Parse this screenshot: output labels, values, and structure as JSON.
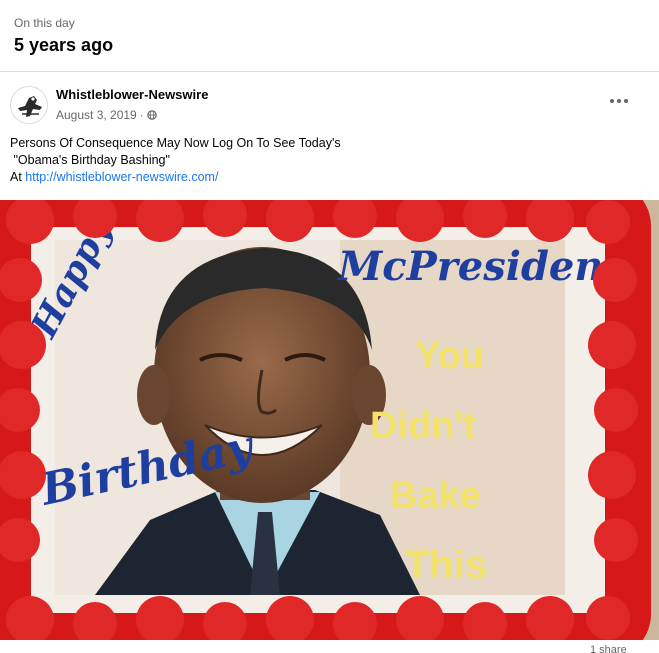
{
  "memory": {
    "kicker": "On this day",
    "title": "5 years ago"
  },
  "post": {
    "author": "Whistleblower-Newswire",
    "date": "August 3, 2019",
    "date_separator": "·",
    "visibility_icon": "globe-icon",
    "more_icon": "more-options-icon",
    "caption_line1": "Persons Of Consequence May Now Log On To See Today's",
    "caption_line2": " \"Obama's Birthday Bashing\"",
    "caption_prefix": "At ",
    "caption_link": "http://whistleblower-newswire.com/",
    "shares": "1 share"
  },
  "photo": {
    "cake_text_left_1": "Happy",
    "cake_text_left_2": "Birthday",
    "cake_text_top": "McPresident",
    "cake_text_right": [
      "You",
      "Didn't",
      "Bake",
      "This"
    ]
  },
  "colors": {
    "link": "#1877f2",
    "frosting_red": "#d61818",
    "cake_text_blue": "#1e3fa0",
    "cake_text_yellow": "#f3e26a"
  }
}
